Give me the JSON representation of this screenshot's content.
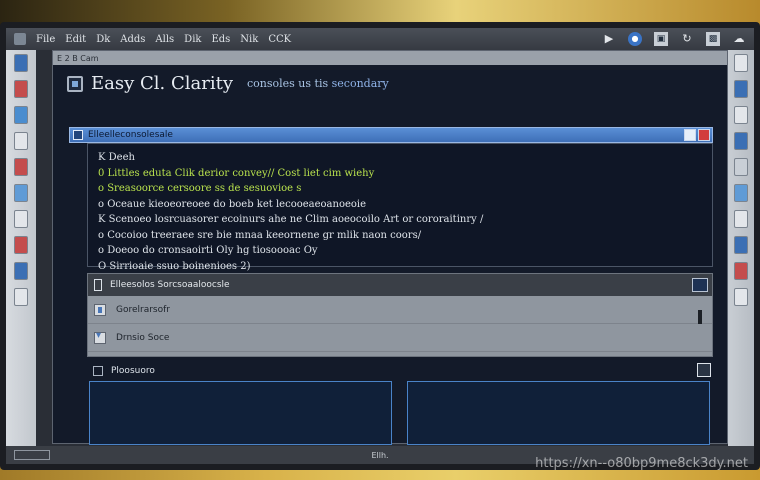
{
  "taskbar": {
    "menu": [
      "File",
      "Edit",
      "Dk",
      "Adds",
      "Alls",
      "Dik",
      "Eds",
      "Nik",
      "CCK"
    ],
    "tray": [
      "play",
      "globe",
      "window",
      "refresh",
      "display",
      "cloud"
    ]
  },
  "window": {
    "chrome_text": "E 2 B Cam",
    "title": "Easy Cl. Clarity",
    "subtitle_pre": "consoles us tis",
    "subtitle_link": "secondary"
  },
  "cmd_bar": {
    "label": "Elleelleconsolesale"
  },
  "console": {
    "lines": [
      {
        "text": "K Deeh",
        "style": "plain"
      },
      {
        "text": "0  Littles eduta Clik derior convey//  Cost liet cim wiehy",
        "style": "green"
      },
      {
        "text": "o  Sreasoorce cersoore ss de sesuovioe s",
        "style": "green"
      },
      {
        "text": "o  Oceaue kieoeoreoee do boeb ket lecooeaeoanoeoie",
        "style": "plain"
      },
      {
        "text": "K  Scenoeo losrcuasorer ecoinurs ahe ne Clim aoeocoilo Art or cororaitinry /",
        "style": "plain"
      },
      {
        "text": "o  Cocoioo treeraee sre bie mnaa keeornene gr mlik naon coors/",
        "style": "plain"
      },
      {
        "text": "o  Doeoo do cronsaoirti Oly hg tiosoooac Oy",
        "style": "plain"
      },
      {
        "text": "O  Sirrioaie ssuo boinenioes 2)",
        "style": "plain"
      }
    ]
  },
  "list": {
    "header": "Elleesolos Sorcsoaaloocsle",
    "rows": [
      {
        "label": "Gorelrarsofr",
        "icon": "document-icon"
      },
      {
        "label": "Drnsio Soce",
        "icon": "download-icon"
      }
    ]
  },
  "bottom": {
    "header": "Ploosuoro"
  },
  "status": {
    "text": "Ellh."
  },
  "watermark": "https://xn--o80bp9me8ck3dy.net"
}
